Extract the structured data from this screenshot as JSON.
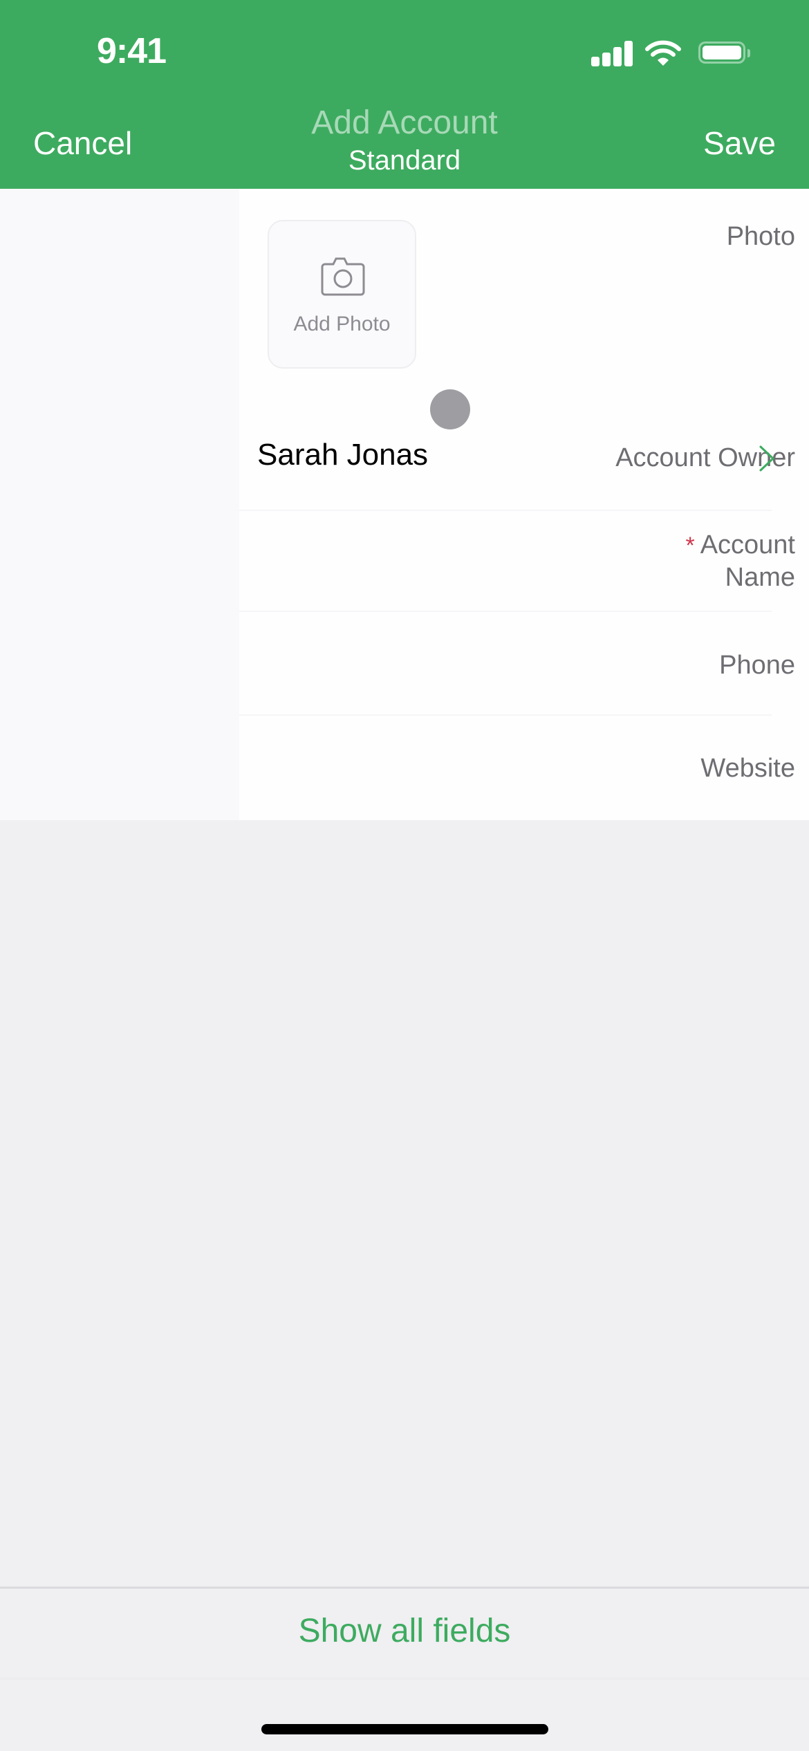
{
  "status_bar": {
    "time": "9:41",
    "icons": [
      "signal-icon",
      "wifi-icon",
      "battery-icon"
    ]
  },
  "nav": {
    "cancel_label": "Cancel",
    "title": "Add Account",
    "subtitle": "Standard",
    "save_label": "Save"
  },
  "form": {
    "fields": [
      {
        "label": "Photo",
        "type": "photo",
        "button_label": "Add Photo",
        "icon": "camera-icon"
      },
      {
        "label": "Account Owner",
        "type": "lookup",
        "value": "Sarah Jonas",
        "icon": "chevron-right-icon"
      },
      {
        "label_line1": "Account",
        "label_line2": "Name",
        "required": true,
        "required_marker": "*",
        "type": "text",
        "value": ""
      },
      {
        "label": "Phone",
        "type": "text",
        "value": ""
      },
      {
        "label": "Website",
        "type": "text",
        "value": ""
      }
    ]
  },
  "footer": {
    "show_all_label": "Show all fields"
  },
  "colors": {
    "brand_green": "#3dab5f",
    "required_red": "#d0364a",
    "label_gray": "#6e6d72"
  }
}
